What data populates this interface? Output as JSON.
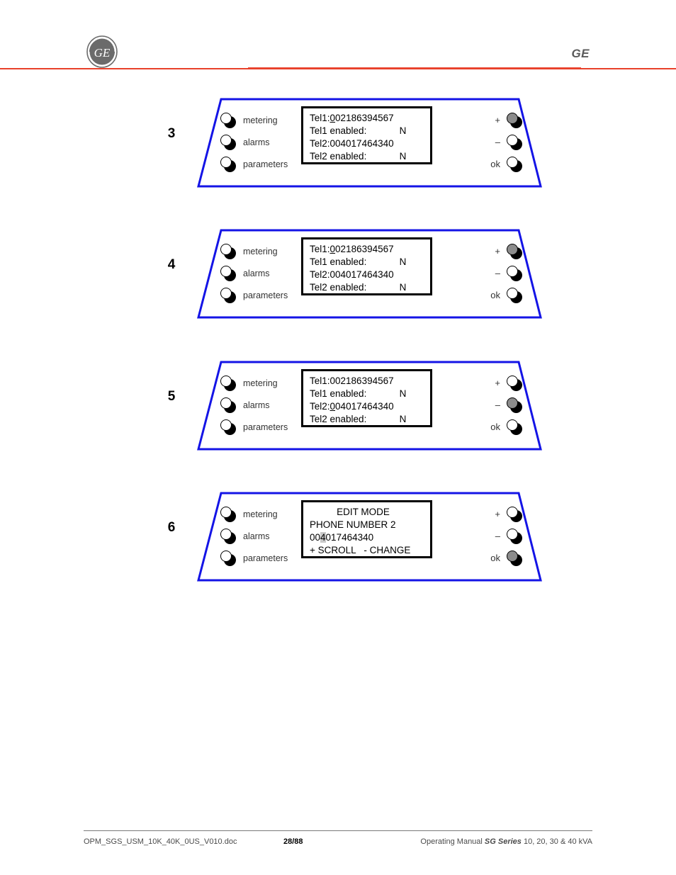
{
  "header": {
    "logo_name": "ge-monogram-logo",
    "wordmark": "GE",
    "rule_color": "#e8402a"
  },
  "panels": [
    {
      "step": "3",
      "side_buttons": [
        {
          "label": "metering",
          "pressed": false
        },
        {
          "label": "alarms",
          "pressed": false
        },
        {
          "label": "parameters",
          "pressed": false
        }
      ],
      "control_buttons": [
        {
          "label": "+",
          "pressed": true
        },
        {
          "label": "–",
          "pressed": false
        },
        {
          "label": "ok",
          "pressed": false
        }
      ],
      "lcd": {
        "centered": false,
        "lines": [
          {
            "prefix": "Tel1:",
            "cursor": "0",
            "cursor_style": "underline",
            "rest": "02186394567",
            "flag": ""
          },
          {
            "prefix": "Tel1 enabled:",
            "cursor": "",
            "cursor_style": "none",
            "rest": "",
            "flag": "N"
          },
          {
            "prefix": "Tel2:004017464340",
            "cursor": "",
            "cursor_style": "none",
            "rest": "",
            "flag": ""
          },
          {
            "prefix": "Tel2 enabled:",
            "cursor": "",
            "cursor_style": "none",
            "rest": "",
            "flag": "N"
          }
        ]
      }
    },
    {
      "step": "4",
      "side_buttons": [
        {
          "label": "metering",
          "pressed": false
        },
        {
          "label": "alarms",
          "pressed": false
        },
        {
          "label": "parameters",
          "pressed": false
        }
      ],
      "control_buttons": [
        {
          "label": "+",
          "pressed": true
        },
        {
          "label": "–",
          "pressed": false
        },
        {
          "label": "ok",
          "pressed": false
        }
      ],
      "lcd": {
        "centered": false,
        "lines": [
          {
            "prefix": "Tel1:",
            "cursor": "0",
            "cursor_style": "underline",
            "rest": "02186394567",
            "flag": ""
          },
          {
            "prefix": "Tel1 enabled:",
            "cursor": "",
            "cursor_style": "none",
            "rest": "",
            "flag": "N"
          },
          {
            "prefix": "Tel2:004017464340",
            "cursor": "",
            "cursor_style": "none",
            "rest": "",
            "flag": ""
          },
          {
            "prefix": "Tel2 enabled:",
            "cursor": "",
            "cursor_style": "none",
            "rest": "",
            "flag": "N"
          }
        ]
      }
    },
    {
      "step": "5",
      "side_buttons": [
        {
          "label": "metering",
          "pressed": false
        },
        {
          "label": "alarms",
          "pressed": false
        },
        {
          "label": "parameters",
          "pressed": false
        }
      ],
      "control_buttons": [
        {
          "label": "+",
          "pressed": false
        },
        {
          "label": "–",
          "pressed": true
        },
        {
          "label": "ok",
          "pressed": false
        }
      ],
      "lcd": {
        "centered": false,
        "lines": [
          {
            "prefix": "Tel1:002186394567",
            "cursor": "",
            "cursor_style": "none",
            "rest": "",
            "flag": ""
          },
          {
            "prefix": "Tel1 enabled:",
            "cursor": "",
            "cursor_style": "none",
            "rest": "",
            "flag": "N"
          },
          {
            "prefix": "Tel2:",
            "cursor": "0",
            "cursor_style": "underline",
            "rest": "04017464340",
            "flag": ""
          },
          {
            "prefix": "Tel2 enabled:",
            "cursor": "",
            "cursor_style": "none",
            "rest": "",
            "flag": "N"
          }
        ]
      }
    },
    {
      "step": "6",
      "side_buttons": [
        {
          "label": "metering",
          "pressed": false
        },
        {
          "label": "alarms",
          "pressed": false
        },
        {
          "label": "parameters",
          "pressed": false
        }
      ],
      "control_buttons": [
        {
          "label": "+",
          "pressed": false
        },
        {
          "label": "–",
          "pressed": false
        },
        {
          "label": "ok",
          "pressed": true
        }
      ],
      "lcd": {
        "centered": true,
        "lines": [
          {
            "prefix": "EDIT MODE",
            "cursor": "",
            "cursor_style": "none",
            "rest": "",
            "flag": "",
            "center": true
          },
          {
            "prefix": "PHONE NUMBER 2",
            "cursor": "",
            "cursor_style": "none",
            "rest": "",
            "flag": ""
          },
          {
            "prefix": "00",
            "cursor": "4",
            "cursor_style": "block",
            "rest": "017464340",
            "flag": ""
          },
          {
            "prefix": "+ SCROLL   - CHANGE",
            "cursor": "",
            "cursor_style": "none",
            "rest": "",
            "flag": ""
          }
        ]
      }
    }
  ],
  "footer": {
    "document": "OPM_SGS_USM_10K_40K_0US_V010.doc",
    "page": "28/88",
    "manual_prefix": "Operating Manual ",
    "manual_series": "SG Series",
    "manual_suffix": " 10, 20, 30 & 40 kVA"
  }
}
